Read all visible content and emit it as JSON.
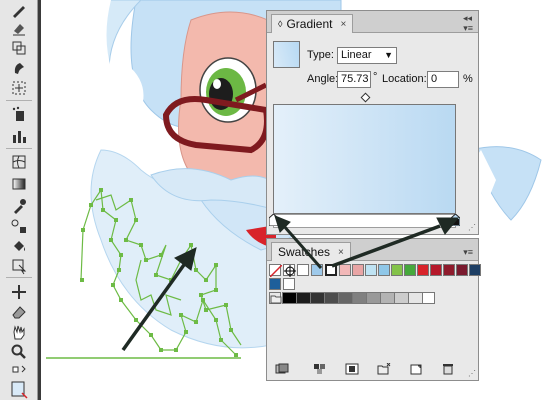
{
  "gradient_panel": {
    "tab_label": "Gradient",
    "close_glyph": "×",
    "type_label": "Type:",
    "type_value": "Linear",
    "angle_label": "Angle:",
    "angle_value": "75.73",
    "degree_symbol": "°",
    "location_label": "Location:",
    "location_value": "0",
    "percent_symbol": "%",
    "gradient_colors": [
      "#d9eaf8",
      "#b7d9f3"
    ]
  },
  "swatches_panel": {
    "tab_label": "Swatches",
    "close_glyph": "×",
    "color_swatches": [
      "#f2b8b8",
      "#e9a5a5",
      "#bfe3f3",
      "#8fc7e8",
      "#84c34a",
      "#46a83c",
      "#d8232a",
      "#b5182a",
      "#8e1b2c",
      "#7a1a2e",
      "#1d3e64"
    ],
    "row2_swatches": [
      "#1e5f9b",
      "#ffffff"
    ],
    "gray_swatches": [
      "#000000",
      "#1c1c1c",
      "#333333",
      "#4d4d4d",
      "#666666",
      "#808080",
      "#999999",
      "#b3b3b3",
      "#cccccc",
      "#e6e6e6",
      "#ffffff"
    ]
  },
  "colors": {
    "outline_green": "#6dbb45",
    "hair_blue": "#c6e1f6",
    "skin": "#f3b9ad",
    "glasses": "#7f1a1f",
    "arrow": "#1f2a24"
  }
}
